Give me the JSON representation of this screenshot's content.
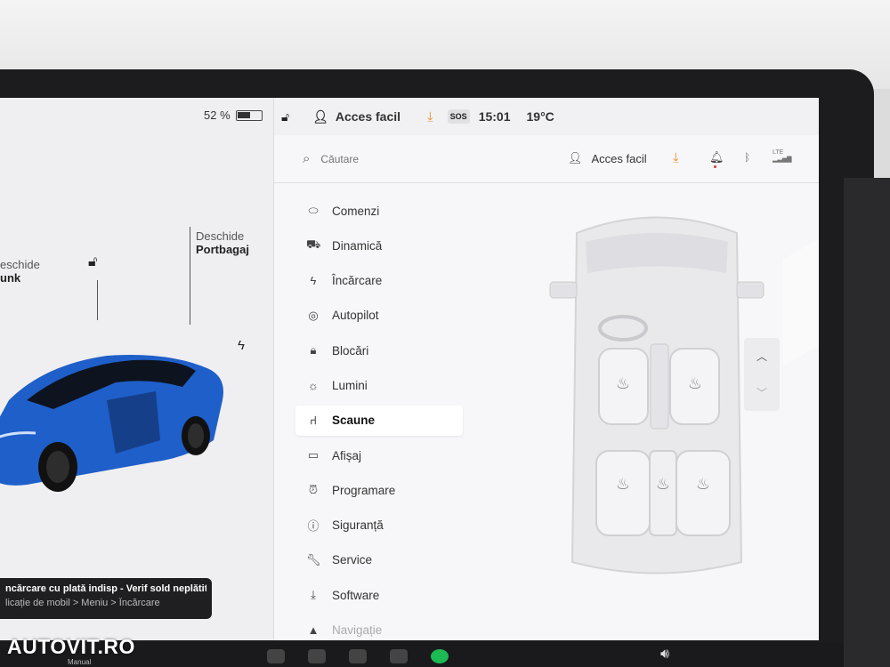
{
  "status_bar": {
    "battery_percent": "52 %",
    "battery_level": 0.52,
    "profile": "Acces facil",
    "sos": "SOS",
    "time": "15:01",
    "temperature": "19°C"
  },
  "car": {
    "frunk_action": "eschide",
    "frunk_target": "unk",
    "trunk_action": "Deschide",
    "trunk_target": "Portbagaj",
    "body_color": "#1f5fc9"
  },
  "notification": {
    "title": "ncărcare cu plată indisp - Verif sold neplătit",
    "subtitle": "licație de mobil > Meniu > Încărcare"
  },
  "search": {
    "placeholder": "Căutare",
    "profile": "Acces facil",
    "lte": "LTE"
  },
  "menu": {
    "items": [
      {
        "label": "Comenzi",
        "icon": "toggle-icon"
      },
      {
        "label": "Dinamică",
        "icon": "car-icon"
      },
      {
        "label": "Încărcare",
        "icon": "bolt-icon"
      },
      {
        "label": "Autopilot",
        "icon": "steering-wheel-icon"
      },
      {
        "label": "Blocări",
        "icon": "lock-icon"
      },
      {
        "label": "Lumini",
        "icon": "light-icon"
      },
      {
        "label": "Scaune",
        "icon": "seat-icon"
      },
      {
        "label": "Afișaj",
        "icon": "display-icon"
      },
      {
        "label": "Programare",
        "icon": "alarm-icon"
      },
      {
        "label": "Siguranță",
        "icon": "info-icon"
      },
      {
        "label": "Service",
        "icon": "wrench-icon"
      },
      {
        "label": "Software",
        "icon": "download-icon"
      },
      {
        "label": "Navigație",
        "icon": "navigation-icon"
      }
    ],
    "active_index": 6
  },
  "taskbar": {
    "gear_label": "Manual"
  },
  "watermark": "AUTOVIT.RO",
  "colors": {
    "accent_download": "#e8912d",
    "screen_bg": "#f1f1f3"
  }
}
